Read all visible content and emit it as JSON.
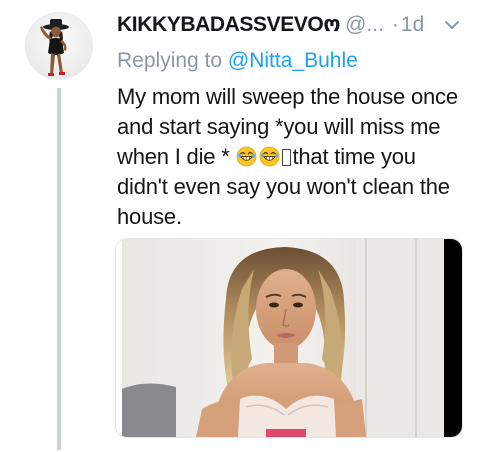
{
  "tweet": {
    "display_name": "KIKKYBADASSVEVOო",
    "handle": "@...",
    "separator": "·",
    "timestamp": "1d",
    "replying_prefix": "Replying to ",
    "replying_to": "@Nitta_Buhle",
    "text_lines": [
      "My mom will sweep the house once",
      "and start saying *you will miss me",
      "when I die * ",
      "that time you",
      "didn't even say you won't clean the",
      "house."
    ],
    "icons": {
      "avatar": "user-avatar-photo",
      "more": "chevron-down-icon",
      "emoji": "grinning-face-with-tears-emoji"
    },
    "colors": {
      "text": "#14171a",
      "secondary": "#8899a6",
      "link": "#1da1f2",
      "thread_line": "#c6d1d9"
    }
  }
}
